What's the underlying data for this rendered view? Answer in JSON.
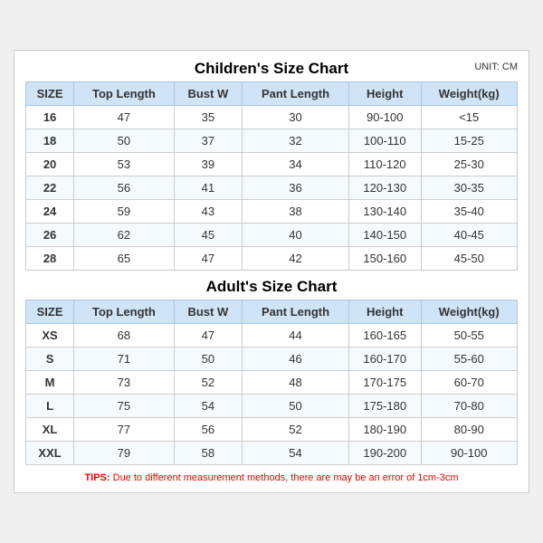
{
  "children": {
    "title": "Children's Size Chart",
    "unit": "UNIT: CM",
    "headers": [
      "SIZE",
      "Top Length",
      "Bust W",
      "Pant Length",
      "Height",
      "Weight(kg)"
    ],
    "rows": [
      [
        "16",
        "47",
        "35",
        "30",
        "90-100",
        "<15"
      ],
      [
        "18",
        "50",
        "37",
        "32",
        "100-110",
        "15-25"
      ],
      [
        "20",
        "53",
        "39",
        "34",
        "110-120",
        "25-30"
      ],
      [
        "22",
        "56",
        "41",
        "36",
        "120-130",
        "30-35"
      ],
      [
        "24",
        "59",
        "43",
        "38",
        "130-140",
        "35-40"
      ],
      [
        "26",
        "62",
        "45",
        "40",
        "140-150",
        "40-45"
      ],
      [
        "28",
        "65",
        "47",
        "42",
        "150-160",
        "45-50"
      ]
    ]
  },
  "adults": {
    "title": "Adult's Size Chart",
    "headers": [
      "SIZE",
      "Top Length",
      "Bust W",
      "Pant Length",
      "Height",
      "Weight(kg)"
    ],
    "rows": [
      [
        "XS",
        "68",
        "47",
        "44",
        "160-165",
        "50-55"
      ],
      [
        "S",
        "71",
        "50",
        "46",
        "160-170",
        "55-60"
      ],
      [
        "M",
        "73",
        "52",
        "48",
        "170-175",
        "60-70"
      ],
      [
        "L",
        "75",
        "54",
        "50",
        "175-180",
        "70-80"
      ],
      [
        "XL",
        "77",
        "56",
        "52",
        "180-190",
        "80-90"
      ],
      [
        "XXL",
        "79",
        "58",
        "54",
        "190-200",
        "90-100"
      ]
    ]
  },
  "tips": {
    "label": "TIPS:",
    "text": " Due to different measurement methods, there are may be an error of 1cm-3cm"
  }
}
